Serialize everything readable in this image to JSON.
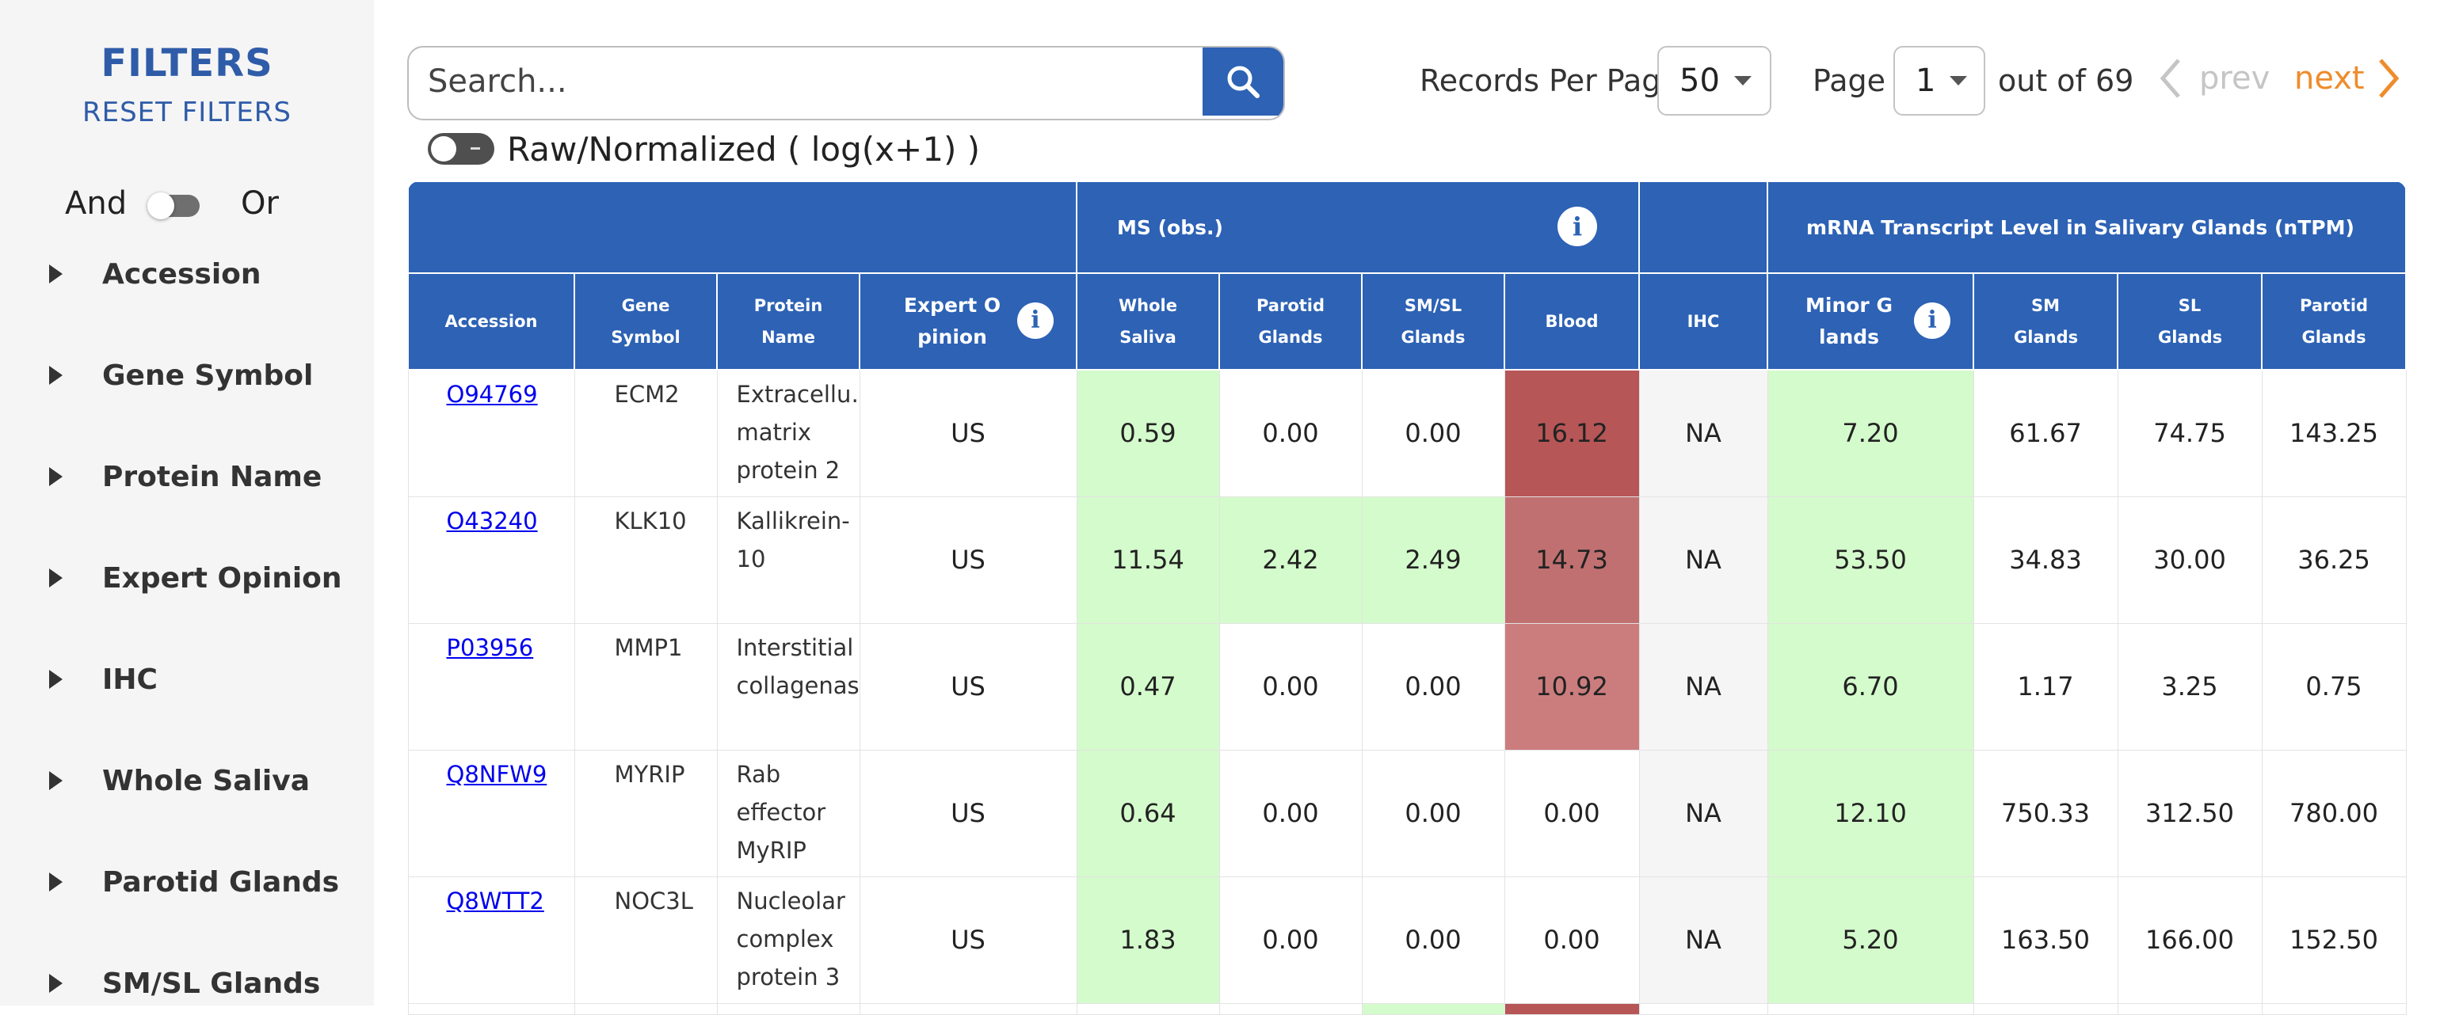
{
  "sidebar": {
    "title": "FILTERS",
    "reset": "RESET FILTERS",
    "and_label": "And",
    "or_label": "Or",
    "items": [
      {
        "label": "Accession"
      },
      {
        "label": "Gene Symbol"
      },
      {
        "label": "Protein Name"
      },
      {
        "label": "Expert Opinion"
      },
      {
        "label": "IHC"
      },
      {
        "label": "Whole Saliva"
      },
      {
        "label": "Parotid Glands"
      },
      {
        "label": "SM/SL Glands"
      }
    ]
  },
  "search": {
    "placeholder": "Search...",
    "icon": "search-icon"
  },
  "pagination": {
    "records_label": "Records Per Page",
    "records_value": "50",
    "page_label": "Page",
    "page_value": "1",
    "out_of": "out of 69",
    "prev": "prev",
    "next": "next"
  },
  "normalize": {
    "label": "Raw/Normalized ( log(x+1) )"
  },
  "table": {
    "groups": {
      "ms": "MS (obs.)",
      "mrna": "mRNA Transcript Level in Salivary Glands (nTPM)"
    },
    "headers": {
      "accession": "Accession",
      "gene": "Gene Symbol",
      "protein": "Protein Name",
      "expert": "Expert Opinion",
      "whole": "Whole Saliva",
      "parotid": "Parotid Glands",
      "smsl": "SM/SL Glands",
      "blood": "Blood",
      "ihc": "IHC",
      "minor": "Minor Glands",
      "sm": "SM Glands",
      "sl": "SL Glands",
      "parotid2": "Parotid Glands"
    },
    "rows": [
      {
        "accession": "O94769",
        "gene": "ECM2",
        "protein": "Extracellu…\nmatrix\nprotein 2",
        "expert": "US",
        "whole": "0.59",
        "parotid": "0.00",
        "smsl": "0.00",
        "blood": "16.12",
        "ihc": "NA",
        "minor": "7.20",
        "sm": "61.67",
        "sl": "74.75",
        "parotid2": "143.25"
      },
      {
        "accession": "O43240",
        "gene": "KLK10",
        "protein": "Kallikrein-\n10",
        "expert": "US",
        "whole": "11.54",
        "parotid": "2.42",
        "smsl": "2.49",
        "blood": "14.73",
        "ihc": "NA",
        "minor": "53.50",
        "sm": "34.83",
        "sl": "30.00",
        "parotid2": "36.25"
      },
      {
        "accession": "P03956",
        "gene": "MMP1",
        "protein": "Interstitial\ncollagenase",
        "expert": "US",
        "whole": "0.47",
        "parotid": "0.00",
        "smsl": "0.00",
        "blood": "10.92",
        "ihc": "NA",
        "minor": "6.70",
        "sm": "1.17",
        "sl": "3.25",
        "parotid2": "0.75"
      },
      {
        "accession": "Q8NFW9",
        "gene": "MYRIP",
        "protein": "Rab\neffector\nMyRIP",
        "expert": "US",
        "whole": "0.64",
        "parotid": "0.00",
        "smsl": "0.00",
        "blood": "0.00",
        "ihc": "NA",
        "minor": "12.10",
        "sm": "750.33",
        "sl": "312.50",
        "parotid2": "780.00"
      },
      {
        "accession": "Q8WTT2",
        "gene": "NOC3L",
        "protein": "Nucleolar\ncomplex\nprotein 3",
        "expert": "US",
        "whole": "1.83",
        "parotid": "0.00",
        "smsl": "0.00",
        "blood": "0.00",
        "ihc": "NA",
        "minor": "5.20",
        "sm": "163.50",
        "sl": "166.00",
        "parotid2": "152.50"
      }
    ],
    "colors": {
      "header": "#2d62b5",
      "green": "#d4fbcc",
      "blood_dark": "#b75657",
      "blood_mid": "#c07070",
      "blood_light": "#cb7d7e"
    }
  }
}
